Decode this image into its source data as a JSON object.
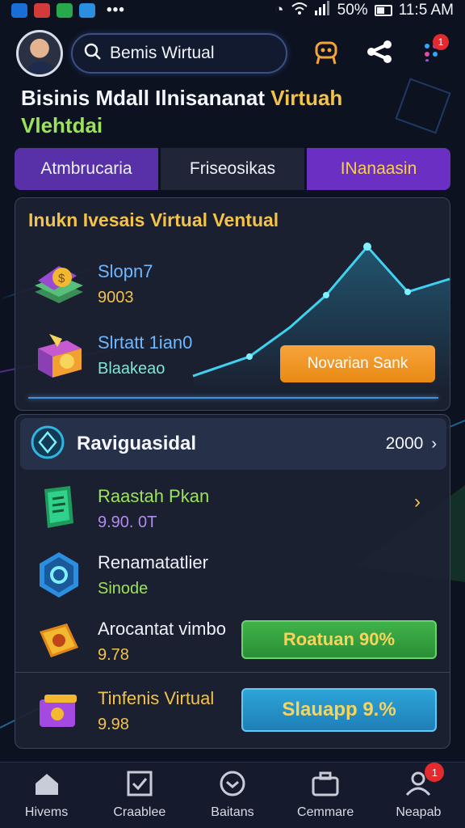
{
  "status_bar": {
    "battery": "50%",
    "time": "11:5 AM"
  },
  "header": {
    "search_value": "Bemis Wirtual",
    "notifications_count": "1"
  },
  "title": {
    "line1_part1": "Bisinis Mdall ",
    "line1_part2": "Ilnisananat ",
    "line1_part3": "Virtuah",
    "line2": "Vlehtdai"
  },
  "tabs": [
    {
      "label": "Atmbrucaria"
    },
    {
      "label": "Friseosikas"
    },
    {
      "label": "INanaasin"
    }
  ],
  "investment_card": {
    "title": "Inukn Ivesais Virtual Ventual",
    "items": [
      {
        "name": "Slopn7",
        "value": "9003"
      },
      {
        "name": "Slrtatt 1ian0",
        "value": "Blaakeao"
      }
    ],
    "action_label": "Novarian Sank"
  },
  "list_card": {
    "header_label": "Raviguasidal",
    "header_value": "2000",
    "rows": [
      {
        "label": "Raastah Pkan",
        "value": "9.90. 0T"
      },
      {
        "label": "Renamatatlier",
        "value": "Sinode"
      },
      {
        "label": "Arocantat vimbo",
        "value": "9.78"
      },
      {
        "label": "Tinfenis Virtual",
        "value": "9.98"
      }
    ],
    "green_button": "Roatuan 90%",
    "blue_button": "Slauapp 9.%"
  },
  "bottom_nav": [
    {
      "label": "Hivems",
      "icon": "home-icon"
    },
    {
      "label": "Craablee",
      "icon": "checkbox-icon"
    },
    {
      "label": "Baitans",
      "icon": "chevron-circle-icon"
    },
    {
      "label": "Cemmare",
      "icon": "briefcase-icon"
    },
    {
      "label": "Neapab",
      "icon": "user-icon",
      "badge": "1"
    }
  ],
  "colors": {
    "background": "#0c1220",
    "accent_yellow": "#f3c24a",
    "accent_green": "#9be35b",
    "tab_purple": "#6b2fc4",
    "button_orange": "#f7a33a",
    "button_green": "#3fb24a",
    "button_blue": "#2da4d8"
  }
}
